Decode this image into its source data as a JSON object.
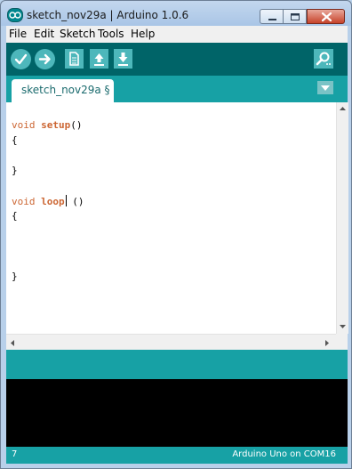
{
  "window": {
    "title": "sketch_nov29a | Arduino 1.0.6",
    "app_icon": "arduino-logo-icon"
  },
  "menubar": {
    "items": [
      "File",
      "Edit",
      "Sketch",
      "Tools",
      "Help"
    ]
  },
  "toolbar": {
    "buttons": [
      {
        "name": "verify",
        "icon": "checkmark-icon"
      },
      {
        "name": "upload",
        "icon": "arrow-right-icon"
      },
      {
        "name": "new",
        "icon": "new-document-icon"
      },
      {
        "name": "open",
        "icon": "arrow-up-icon"
      },
      {
        "name": "save",
        "icon": "arrow-down-icon"
      },
      {
        "name": "serial-monitor",
        "icon": "magnifier-icon"
      }
    ]
  },
  "tabs": {
    "items": [
      {
        "label": "sketch_nov29a §"
      }
    ],
    "menu_icon": "triangle-down-icon"
  },
  "editor": {
    "lines": [
      {
        "type": "void",
        "fn": "setup",
        "rest": "()"
      },
      {
        "text": "{"
      },
      {
        "text": ""
      },
      {
        "text": "}"
      },
      {
        "text": ""
      },
      {
        "type": "void",
        "fn": "loop",
        "rest": " ()"
      },
      {
        "text": "{"
      },
      {
        "text": ""
      },
      {
        "text": ""
      },
      {
        "text": ""
      },
      {
        "text": "}"
      }
    ]
  },
  "status": {
    "line_number": "7",
    "board": "Arduino Uno on COM16"
  },
  "colors": {
    "toolbar": "#006468",
    "tab_bar": "#17a1a5",
    "button": "#4db7bb",
    "keyword": "#cc6633",
    "console": "#000000"
  }
}
